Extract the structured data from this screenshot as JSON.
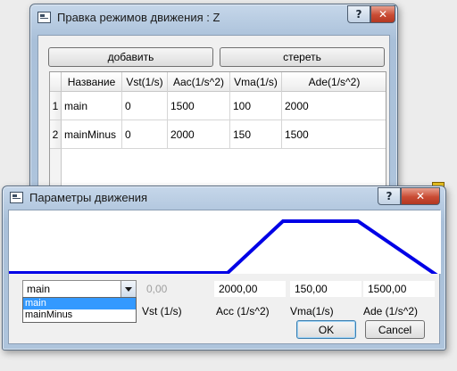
{
  "window_main": {
    "title": "Правка режимов движения : Z",
    "add_label": "добавить",
    "clear_label": "стереть",
    "columns": [
      "Название",
      "Vst(1/s)",
      "Aac(1/s^2)",
      "Vma(1/s)",
      "Ade(1/s^2)"
    ],
    "rows": [
      {
        "index": "1",
        "cells": [
          "main",
          "0",
          "1500",
          "100",
          "2000"
        ]
      },
      {
        "index": "2",
        "cells": [
          "mainMinus",
          "0",
          "2000",
          "150",
          "1500"
        ]
      }
    ]
  },
  "dialog": {
    "title": "Параметры движения",
    "combo_value": "main",
    "combo_options": [
      "main",
      "mainMinus"
    ],
    "vst_value": "0,00",
    "acc_value": "2000,00",
    "vma_value": "150,00",
    "ade_value": "1500,00",
    "vst_label": "Vst (1/s)",
    "acc_label": "Acc (1/s^2)",
    "vma_label": "Vma(1/s)",
    "ade_label": "Ade (1/s^2)",
    "ok_label": "OK",
    "cancel_label": "Cancel"
  },
  "profile_colors": {
    "line": "#0000e6",
    "background": "#ffffff"
  },
  "icons": {
    "help": "help-icon",
    "close": "close-icon",
    "app": "app-window-icon",
    "dropdown": "chevron-down-icon"
  }
}
